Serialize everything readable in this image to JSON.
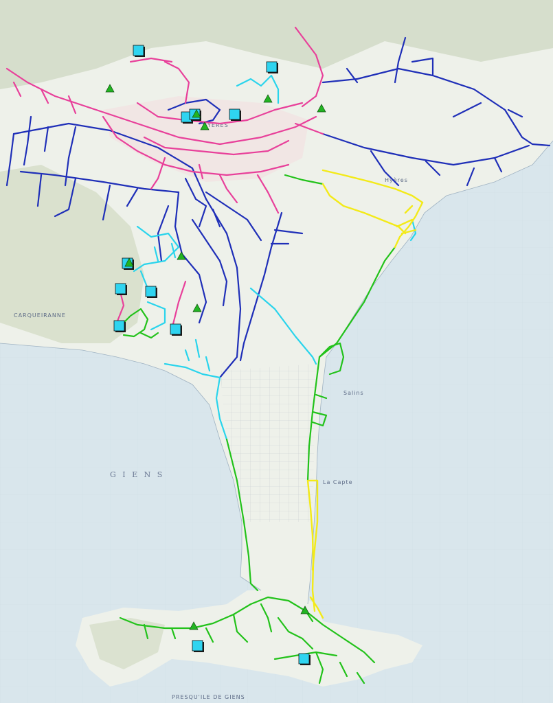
{
  "map": {
    "labels": {
      "town": "HYERES",
      "west_place": "CARQUEIRANNE",
      "bay": "G I E N S",
      "south_coast": "PRESQU'ILE DE GIENS",
      "east_town": "Hyères",
      "salins": "Salins",
      "tombolo": "La Capte"
    },
    "colors": {
      "sea": "#d9e6ec",
      "land": "#eef1ea",
      "relief": "#cfd9c4",
      "urban": "#f1e6e4",
      "network_pink": "#e8409a",
      "network_blue": "#1f2fb8",
      "network_cyan": "#29d4ec",
      "network_green": "#22c21a",
      "network_yellow": "#f3ea18",
      "marker_square": "#2fd4f0",
      "marker_triangle": "#22b422"
    },
    "icons": {
      "square": "reservoir-square-icon",
      "triangle": "pump-triangle-icon"
    }
  }
}
